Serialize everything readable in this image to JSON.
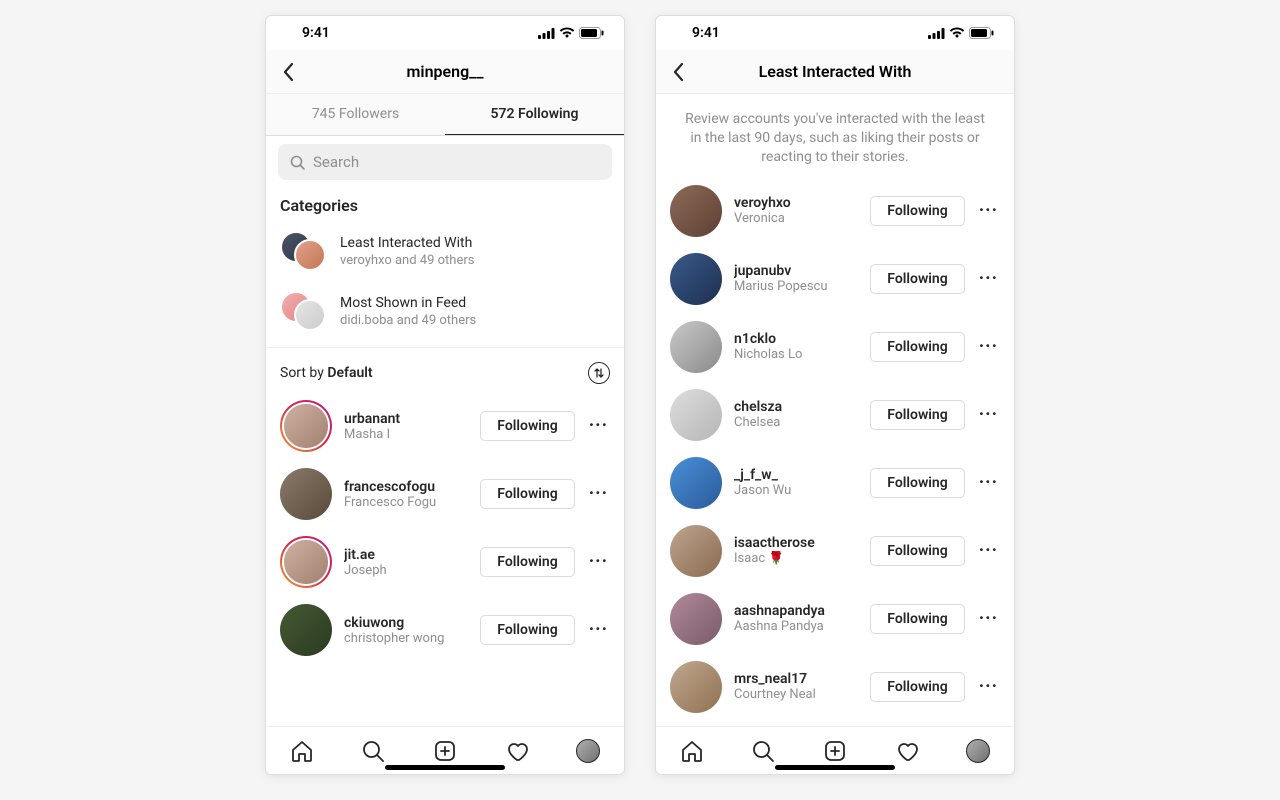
{
  "status": {
    "time": "9:41"
  },
  "phone1": {
    "header_title": "minpeng__",
    "tab_followers": "745 Followers",
    "tab_following": "572 Following",
    "search_placeholder": "Search",
    "categories_label": "Categories",
    "categories": [
      {
        "title": "Least Interacted With",
        "sub": "veroyhxo and 49 others"
      },
      {
        "title": "Most Shown in Feed",
        "sub": "didi.boba and 49 others"
      }
    ],
    "sort_label": "Sort by ",
    "sort_value": "Default",
    "following_button": "Following",
    "users": [
      {
        "username": "urbanant",
        "display": "Masha I",
        "ring": true,
        "av": "av-a1"
      },
      {
        "username": "francescofogu",
        "display": "Francesco Fogu",
        "ring": false,
        "av": "av-a2"
      },
      {
        "username": "jit.ae",
        "display": "Joseph",
        "ring": true,
        "av": "av-a3"
      },
      {
        "username": "ckiuwong",
        "display": "christopher wong",
        "ring": false,
        "av": "av-a4"
      }
    ]
  },
  "phone2": {
    "header_title": "Least Interacted With",
    "description": "Review accounts you've interacted with the least in the last 90 days, such as liking their posts or reacting to their stories.",
    "following_button": "Following",
    "users": [
      {
        "username": "veroyhxo",
        "display": "Veronica",
        "av": "av-b1"
      },
      {
        "username": "jupanubv",
        "display": "Marius Popescu",
        "av": "av-b2"
      },
      {
        "username": "n1cklo",
        "display": "Nicholas Lo",
        "av": "av-b3"
      },
      {
        "username": "chelsza",
        "display": "Chelsea",
        "av": "av-b4"
      },
      {
        "username": "_j_f_w_",
        "display": "Jason Wu",
        "av": "av-b5"
      },
      {
        "username": "isaactherose",
        "display": "Isaac 🌹",
        "av": "av-b6"
      },
      {
        "username": "aashnapandya",
        "display": "Aashna Pandya",
        "av": "av-b7"
      },
      {
        "username": "mrs_neal17",
        "display": "Courtney Neal",
        "av": "av-b8"
      }
    ]
  }
}
